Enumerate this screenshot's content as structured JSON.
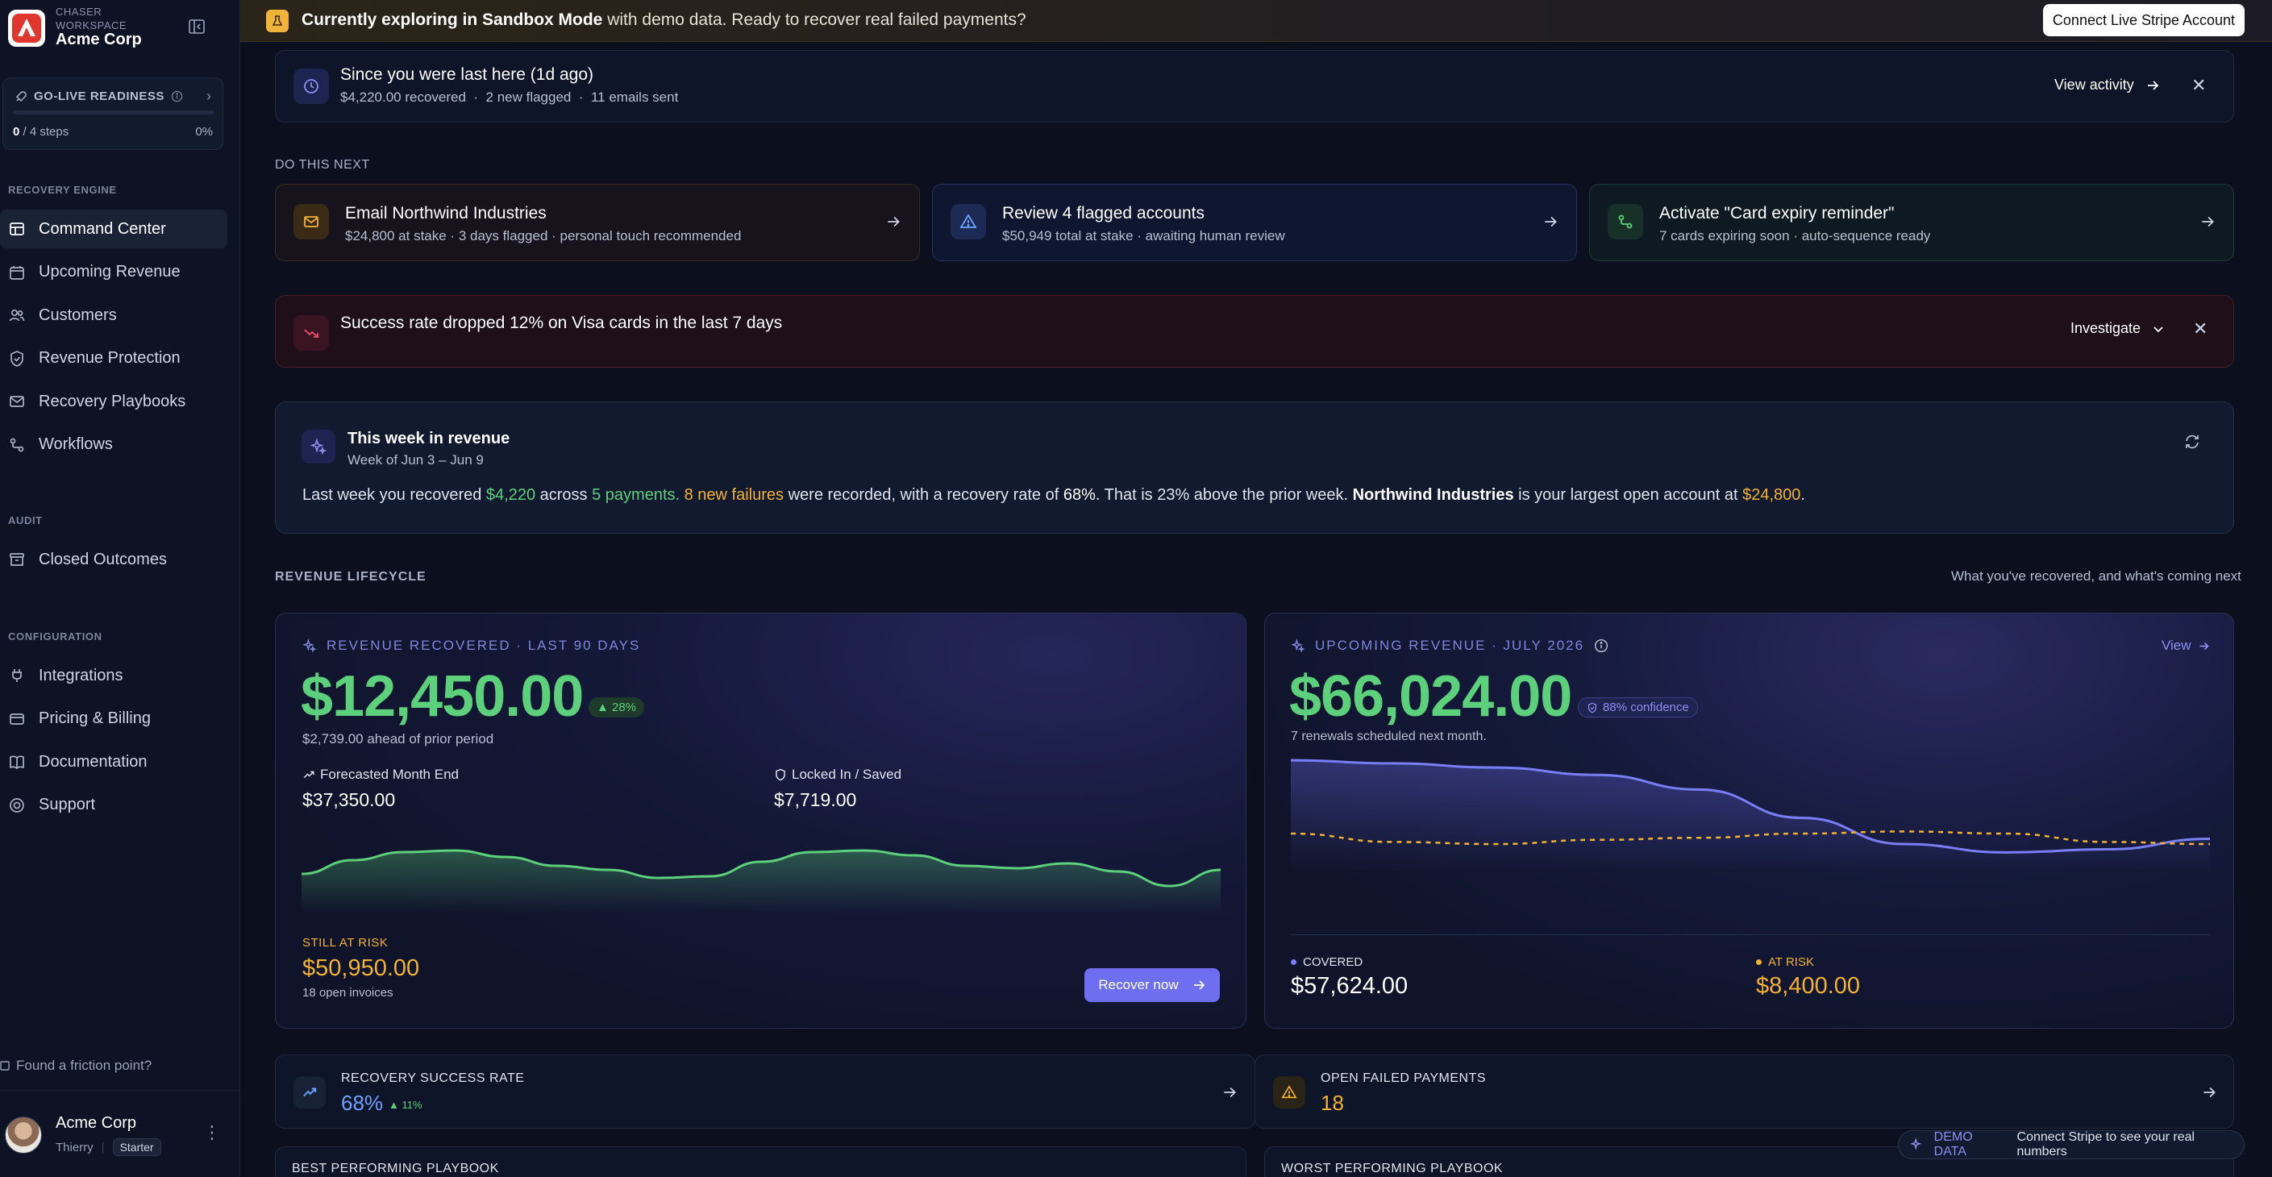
{
  "workspace": {
    "label": "CHASER WORKSPACE",
    "name": "Acme Corp"
  },
  "golive": {
    "title": "GO-LIVE READINESS",
    "steps_done": "0",
    "steps_total": "/ 4 steps",
    "percent": "0%",
    "progress": 0
  },
  "nav": {
    "recovery_section": "RECOVERY ENGINE",
    "recovery_items": [
      {
        "label": "Command Center",
        "icon": "grid-icon",
        "active": true
      },
      {
        "label": "Upcoming Revenue",
        "icon": "calendar-icon"
      },
      {
        "label": "Customers",
        "icon": "users-icon"
      },
      {
        "label": "Revenue Protection",
        "icon": "shield-icon"
      },
      {
        "label": "Recovery Playbooks",
        "icon": "mail-icon"
      },
      {
        "label": "Workflows",
        "icon": "workflow-icon"
      }
    ],
    "audit_section": "AUDIT",
    "audit_items": [
      {
        "label": "Closed Outcomes",
        "icon": "archive-icon"
      }
    ],
    "config_section": "CONFIGURATION",
    "config_items": [
      {
        "label": "Integrations",
        "icon": "plug-icon"
      },
      {
        "label": "Pricing & Billing",
        "icon": "card-icon"
      },
      {
        "label": "Documentation",
        "icon": "book-icon"
      },
      {
        "label": "Support",
        "icon": "lifebuoy-icon"
      }
    ]
  },
  "friction": "Found a friction point?",
  "user": {
    "name": "Acme Corp",
    "handle": "Thierry",
    "plan": "Starter"
  },
  "banner": {
    "bold": "Currently exploring in Sandbox Mode",
    "rest": " with demo data. Ready to recover real failed payments?",
    "cta": "Connect Live Stripe Account"
  },
  "since": {
    "title": "Since you were last here (1d ago)",
    "recovered": "$4,220.00 recovered",
    "flagged": "2 new flagged",
    "emails": "11 emails sent",
    "action": "View activity"
  },
  "next": {
    "label": "DO THIS NEXT",
    "cards": [
      {
        "title": "Email Northwind Industries",
        "sub": "$24,800 at stake · 3 days flagged · personal touch recommended",
        "icon": "mail-icon"
      },
      {
        "title": "Review 4 flagged accounts",
        "sub": "$50,949 total at stake · awaiting human review",
        "icon": "warning-icon"
      },
      {
        "title": "Activate \"Card expiry reminder\"",
        "sub": "7 cards expiring soon · auto-sequence ready",
        "icon": "route-icon"
      }
    ]
  },
  "alert": {
    "title": "Success rate dropped 12% on Visa cards in the last 7 days",
    "action": "Investigate"
  },
  "week": {
    "title": "This week in revenue",
    "sub": "Week of Jun 3 – Jun 9",
    "t1": "Last week you recovered ",
    "amount": "$4,220",
    "t2": " across ",
    "payments": "5 payments.",
    "t3": " ",
    "failures": "8 new failures",
    "t4": " were recorded, with a recovery rate of ",
    "rate": "68%",
    "t5": ". That is ",
    "delta": "23%",
    "t6": " above the prior week. ",
    "account": "Northwind Industries",
    "t7": " is your largest open account at ",
    "account_amount": "$24,800",
    "t8": "."
  },
  "lifecycle": {
    "label": "REVENUE LIFECYCLE",
    "hint": "What you've recovered, and what's coming next"
  },
  "recovered": {
    "kicker": "REVENUE RECOVERED · LAST 90 DAYS",
    "amount": "$12,450.00",
    "badge": "▲ 28%",
    "ahead": "$2,739.00 ahead of prior period",
    "forecast_label": "Forecasted Month End",
    "forecast_value": "$37,350.00",
    "locked_label": "Locked In / Saved",
    "locked_value": "$7,719.00",
    "risk_label": "STILL AT RISK",
    "risk_value": "$50,950.00",
    "risk_sub": "18 open invoices",
    "cta": "Recover now",
    "sparkline": [
      0.45,
      0.62,
      0.72,
      0.74,
      0.66,
      0.55,
      0.5,
      0.4,
      0.42,
      0.6,
      0.72,
      0.74,
      0.68,
      0.55,
      0.52,
      0.58,
      0.48,
      0.3,
      0.5
    ]
  },
  "upcoming": {
    "kicker": "UPCOMING REVENUE · JULY 2026",
    "view": "View",
    "amount": "$66,024.00",
    "confidence": "88% confidence",
    "sub": "7 renewals scheduled next month.",
    "covered_label": "COVERED",
    "covered_value": "$57,624.00",
    "risk_label": "AT RISK",
    "risk_value": "$8,400.00",
    "covered_series": [
      1.0,
      0.97,
      0.93,
      0.86,
      0.72,
      0.45,
      0.2,
      0.12,
      0.15,
      0.25
    ],
    "risk_series": [
      0.3,
      0.22,
      0.2,
      0.24,
      0.26,
      0.3,
      0.32,
      0.3,
      0.22,
      0.2
    ]
  },
  "kpis": [
    {
      "label": "RECOVERY SUCCESS RATE",
      "value": "68%",
      "delta": "▲ 11%"
    },
    {
      "label": "OPEN FAILED PAYMENTS",
      "value": "18"
    }
  ],
  "bottom": [
    "BEST PERFORMING PLAYBOOK",
    "WORST PERFORMING PLAYBOOK"
  ],
  "demo": {
    "tag": "DEMO DATA",
    "text": "Connect Stripe to see your real numbers"
  }
}
